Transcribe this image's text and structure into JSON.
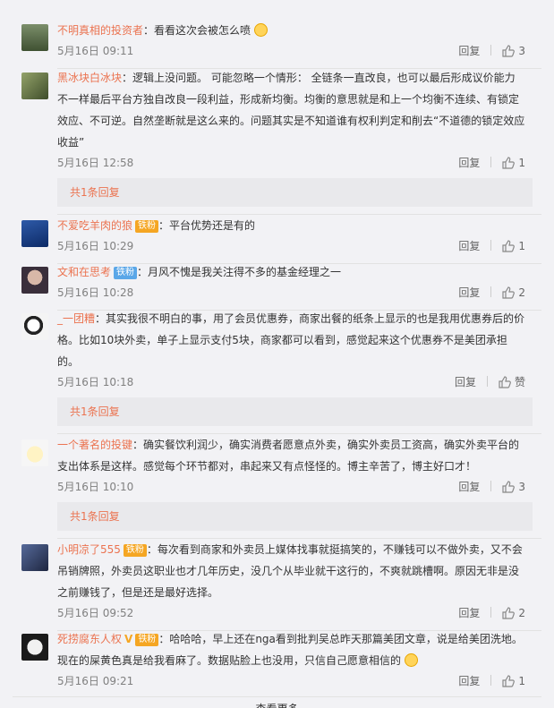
{
  "comments": [
    {
      "user": "不明真相的投资者",
      "text": "看看这次会被怎么喷",
      "time": "5月16日 09:11",
      "reply": "回复",
      "likes": "3"
    },
    {
      "user": "黑冰块白冰块",
      "text": "逻辑上没问题。 可能忽略一个情形： 全链条一直改良，也可以最后形成议价能力不一样最后平台方独自改良一段利益，形成新均衡。均衡的意思就是和上一个均衡不连续、有锁定效应、不可逆。自然垄断就是这么来的。问题其实是不知道谁有权利判定和削去“不道德的锁定效应收益”",
      "time": "5月16日 12:58",
      "reply": "回复",
      "likes": "1",
      "more": "共1条回复"
    },
    {
      "user": "不爱吃羊肉的狼",
      "badge": "铁粉",
      "text": "平台优势还是有的",
      "time": "5月16日 10:29",
      "reply": "回复",
      "likes": "1"
    },
    {
      "user": "文和在思考",
      "badge": "铁粉",
      "text": "月风不愧是我关注得不多的基金经理之一",
      "time": "5月16日 10:28",
      "reply": "回复",
      "likes": "2"
    },
    {
      "user": "_一团糟",
      "text": "其实我很不明白的事，用了会员优惠券，商家出餐的纸条上显示的也是我用优惠券后的价格。比如10块外卖，单子上显示支付5块，商家都可以看到，感觉起来这个优惠券不是美团承担的。",
      "time": "5月16日 10:18",
      "reply": "回复",
      "likes": "赞",
      "more": "共1条回复"
    },
    {
      "user": "一个著名的投键",
      "text": "确实餐饮利润少，确实消费者愿意点外卖，确实外卖员工资高，确实外卖平台的支出体系是这样。感觉每个环节都对，串起来又有点怪怪的。博主辛苦了，博主好口才！",
      "time": "5月16日 10:10",
      "reply": "回复",
      "likes": "3",
      "more": "共1条回复"
    },
    {
      "user": "小明凉了555",
      "badge": "铁粉",
      "text": "每次看到商家和外卖员上媒体找事就挺搞笑的，不赚钱可以不做外卖，又不会吊销牌照，外卖员这职业也才几年历史，没几个从毕业就干这行的，不爽就跳槽啊。原因无非是没之前赚钱了，但是还是最好选择。",
      "time": "5月16日 09:52",
      "reply": "回复",
      "likes": "2"
    },
    {
      "user": "死捞腐东人权",
      "badge": "铁粉",
      "vip": "V",
      "text": "哈哈哈，早上还在nga看到批判吴总昨天那篇美团文章，说是给美团洗地。现在的屎黄色真是给我看麻了。数据贴脸上也没用，只信自己愿意相信的",
      "time": "5月16日 09:21",
      "reply": "回复",
      "likes": "1"
    }
  ],
  "see_more": "查看更多"
}
